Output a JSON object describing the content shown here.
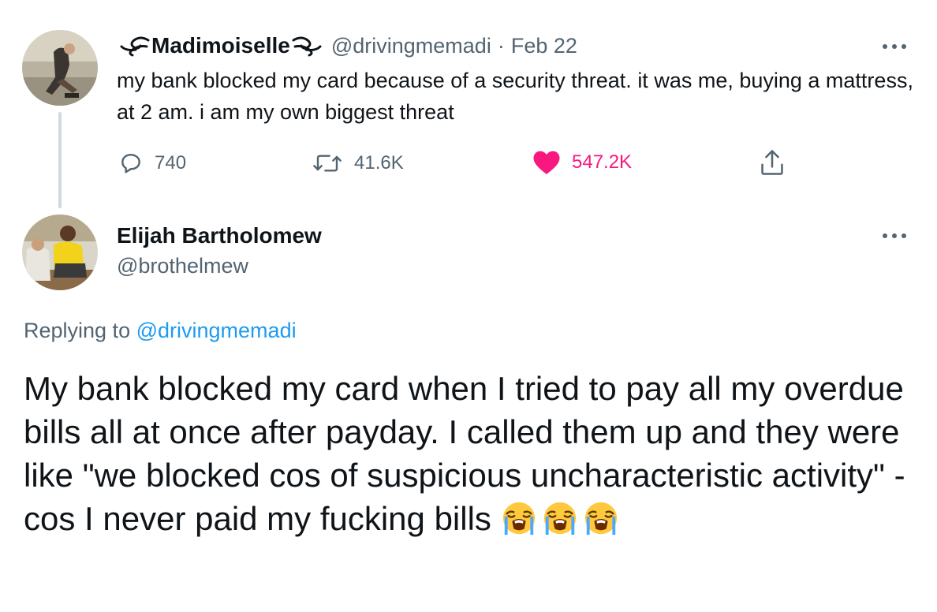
{
  "original_tweet": {
    "display_name": "Madimoiselle",
    "handle": "@drivingmemadi",
    "separator": "·",
    "date": "Feb 22",
    "text": "my bank blocked my card because of a security threat. it was me, buying a mattress, at 2 am. i am my own biggest threat",
    "actions": {
      "replies": "740",
      "retweets": "41.6K",
      "likes": "547.2K"
    }
  },
  "reply_tweet": {
    "display_name": "Elijah Bartholomew",
    "handle": "@brothelmew",
    "replying_prefix": "Replying to",
    "replying_handle": "@drivingmemadi",
    "text": "My bank blocked my card when I tried to pay all my overdue bills all at once after payday. I called them up and they were like \"we blocked cos of suspicious uncharacteristic activity\" - cos I never paid my fucking bills",
    "emoji": [
      "loudly-crying-face",
      "loudly-crying-face",
      "loudly-crying-face"
    ]
  },
  "colors": {
    "text": "#0f1419",
    "muted": "#536471",
    "link": "#1d9bf0",
    "like": "#f91880",
    "thread_line": "#cfd9de"
  },
  "icons": {
    "reply": "reply-icon",
    "retweet": "retweet-icon",
    "like": "heart-icon",
    "share": "share-icon",
    "more": "more-icon"
  }
}
